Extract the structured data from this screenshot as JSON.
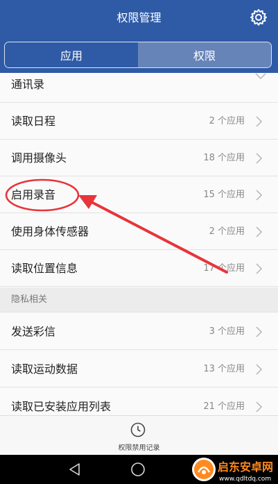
{
  "header": {
    "title": "权限管理",
    "settings_icon": "gear-icon",
    "tabs": [
      {
        "label": "应用",
        "active": false
      },
      {
        "label": "权限",
        "active": true
      }
    ]
  },
  "list": {
    "rows": [
      {
        "label": "通讯录",
        "count": "",
        "chevron": "chevron-down-icon"
      },
      {
        "label": "读取日程",
        "count": "2 个应用",
        "chevron": "chevron-right-icon"
      },
      {
        "label": "调用摄像头",
        "count": "18 个应用",
        "chevron": "chevron-right-icon"
      },
      {
        "label": "启用录音",
        "count": "15 个应用",
        "chevron": "chevron-right-icon"
      },
      {
        "label": "使用身体传感器",
        "count": "2 个应用",
        "chevron": "chevron-right-icon"
      },
      {
        "label": "读取位置信息",
        "count": "17 个应用",
        "chevron": "chevron-right-icon"
      }
    ],
    "section": {
      "label": "隐私相关"
    },
    "privacy_rows": [
      {
        "label": "发送彩信",
        "count": "3 个应用",
        "chevron": "chevron-right-icon"
      },
      {
        "label": "读取运动数据",
        "count": "13 个应用",
        "chevron": "chevron-right-icon"
      },
      {
        "label": "读取已安装应用列表",
        "count": "21 个应用",
        "chevron": "chevron-right-icon"
      }
    ]
  },
  "bottom": {
    "label": "权限禁用记录",
    "icon": "clock-icon"
  },
  "navbar": {
    "icons": [
      "back-icon",
      "home-icon",
      "recents-icon"
    ]
  },
  "watermark": {
    "title": "启东安卓网",
    "url": "www.qdltdq.com"
  },
  "colors": {
    "header_bg": "#2f5ba6",
    "active_tab": "#6784b8",
    "annotation": "#e8343b",
    "watermark_orange": "#ff8a1f"
  }
}
